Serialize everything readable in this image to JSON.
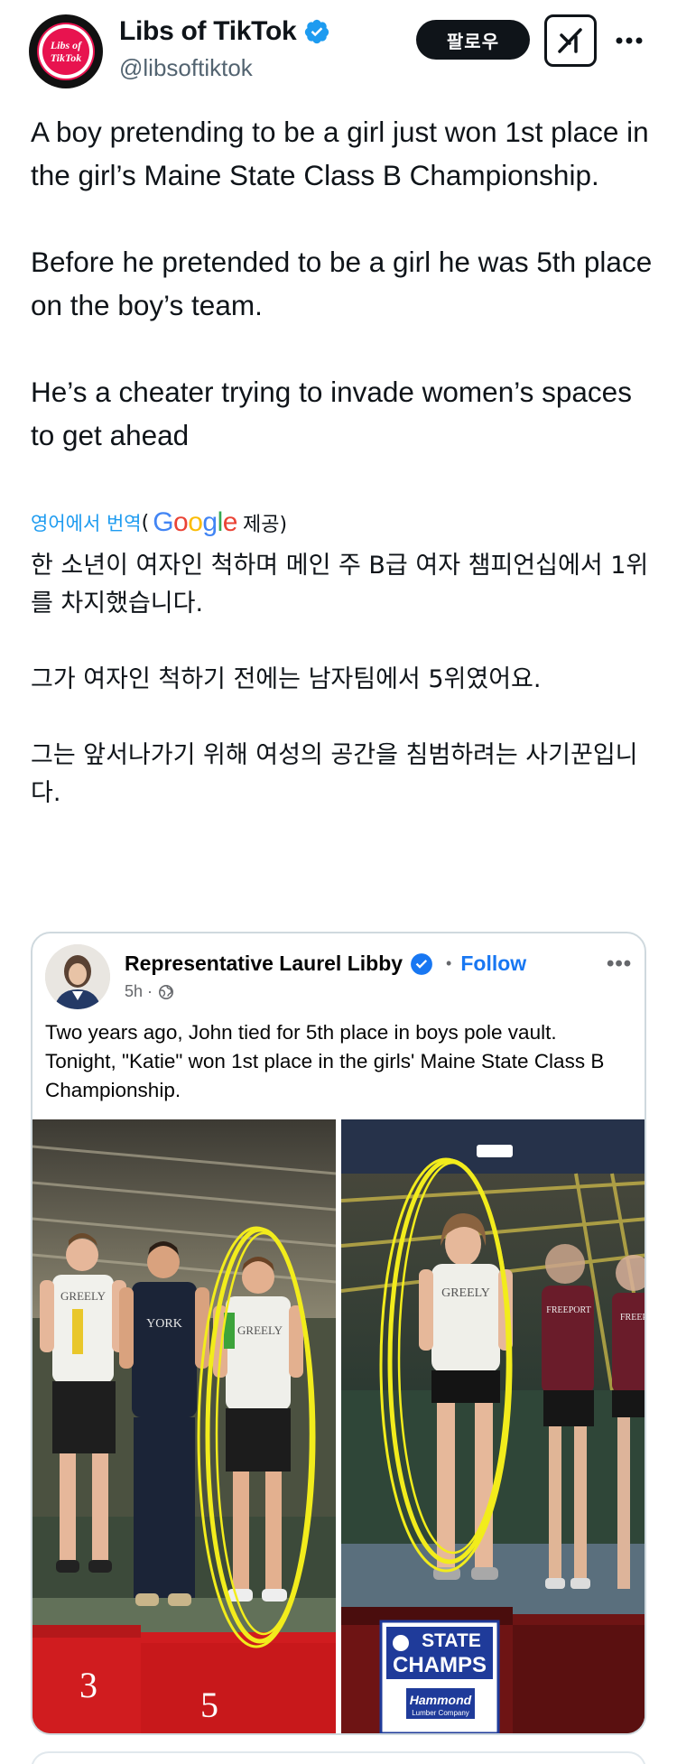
{
  "account": {
    "name": "Libs of TikTok",
    "handle": "@libsoftiktok",
    "avatar_text_1": "Libs of",
    "avatar_text_2": "TikTok",
    "follow_label": "팔로우",
    "verified_icon": "verified-badge-icon",
    "grok_icon": "grok-icon",
    "more_icon": "more-horizontal-icon"
  },
  "tweet": {
    "paragraphs": [
      "A boy pretending to be a girl just won 1st place in the girl’s Maine State Class B Championship.",
      "Before he pretended to be a girl he was 5th place on the boy’s team.",
      "He’s a cheater trying to invade women’s spaces to get ahead"
    ],
    "translate_link": "영어에서 번역",
    "translate_open": "(",
    "translate_provider": "Google",
    "translate_suffix": "제공)",
    "translated_paragraphs": [
      "한 소년이 여자인 척하며 메인 주 B급 여자 챔피언십에서 1위를 차지했습니다.",
      "그가 여자인 척하기 전에는 남자팀에서 5위였어요.",
      "그는 앞서나가기 위해 여성의 공간을 침범하려는 사기꾼입니다."
    ]
  },
  "embedded_post": {
    "author": "Representative Laurel Libby",
    "dot": "•",
    "follow_label": "Follow",
    "time": "5h ·",
    "more": "•••",
    "text": "Two years ago, John tied for 5th place in boys pole vault. Tonight, \"Katie\" won 1st place in the girls' Maine State Class B Championship.",
    "photo_left": {
      "podium_numbers": [
        "3",
        "5"
      ],
      "shirt_texts": [
        "GREELY",
        "YORK",
        "GREELY"
      ]
    },
    "photo_right": {
      "shirt_texts": [
        "GREELY",
        "FREEPORT",
        "FREEP"
      ],
      "sign_line_1": "STATE",
      "sign_line_2": "CHAMPS",
      "sign_line_3": "Hammond",
      "sign_line_4": "Lumber Company"
    },
    "highlight_color": "#f2ec1c"
  },
  "colors": {
    "link": "#1d9bf0",
    "fb_blue": "#1877f2",
    "text": "#0f1419",
    "secondary": "#536471"
  }
}
